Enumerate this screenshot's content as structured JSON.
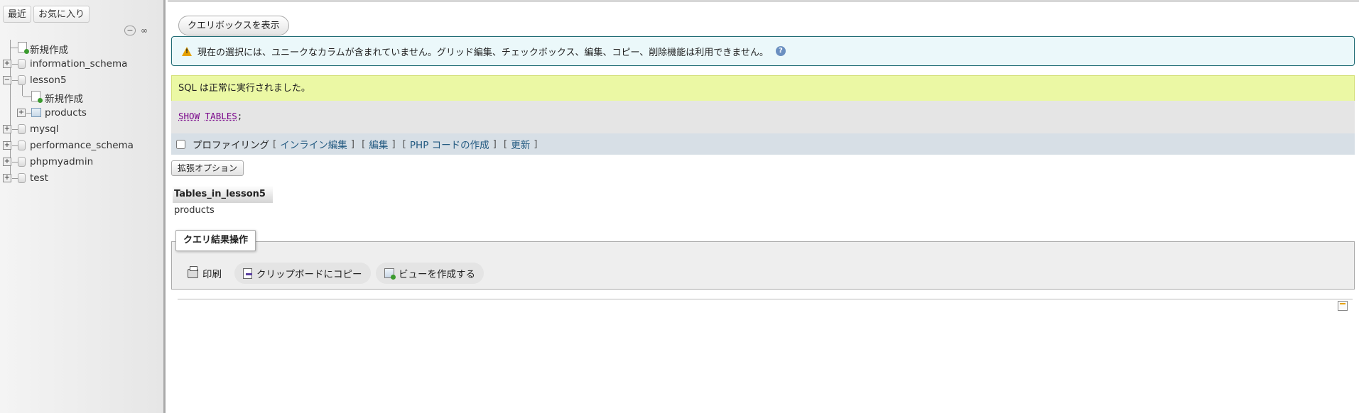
{
  "sidebar": {
    "tabs": {
      "recent": "最近",
      "favorites": "お気に入り"
    },
    "controls": {
      "collapse": "−",
      "link": "∞"
    },
    "tree": {
      "new": "新規作成",
      "information_schema": "information_schema",
      "lesson5": "lesson5",
      "lesson5_new": "新規作成",
      "products": "products",
      "mysql": "mysql",
      "performance_schema": "performance_schema",
      "phpmyadmin": "phpmyadmin",
      "test": "test"
    }
  },
  "main": {
    "show_query_box": "クエリボックスを表示",
    "notice": "現在の選択には、ユニークなカラムが含まれていません。グリッド編集、チェックボックス、編集、コピー、削除機能は利用できません。",
    "success": "SQL は正常に実行されました。",
    "sql": {
      "kw1": "SHOW",
      "kw2": "TABLES",
      "end": ";"
    },
    "profiling": {
      "label": "プロファイリング",
      "inline_edit": "インライン編集",
      "edit": "編集",
      "php_code": "PHP コードの作成",
      "refresh": "更新",
      "open": "[",
      "close": "]"
    },
    "extended_options": "拡張オプション",
    "result": {
      "header": "Tables_in_lesson5",
      "rows": [
        "products"
      ]
    },
    "operations": {
      "legend": "クエリ結果操作",
      "print": "印刷",
      "copy_clipboard": "クリップボードにコピー",
      "create_view": "ビューを作成する"
    }
  },
  "colors": {
    "notice_bg": "#ebf8fa",
    "notice_border": "#1f6b74",
    "success_bg": "#ebf8a4",
    "sql_bg": "#e5e5e5",
    "profiling_bg": "#d7dfe6",
    "link": "#235a81",
    "sql_keyword": "#770088"
  }
}
